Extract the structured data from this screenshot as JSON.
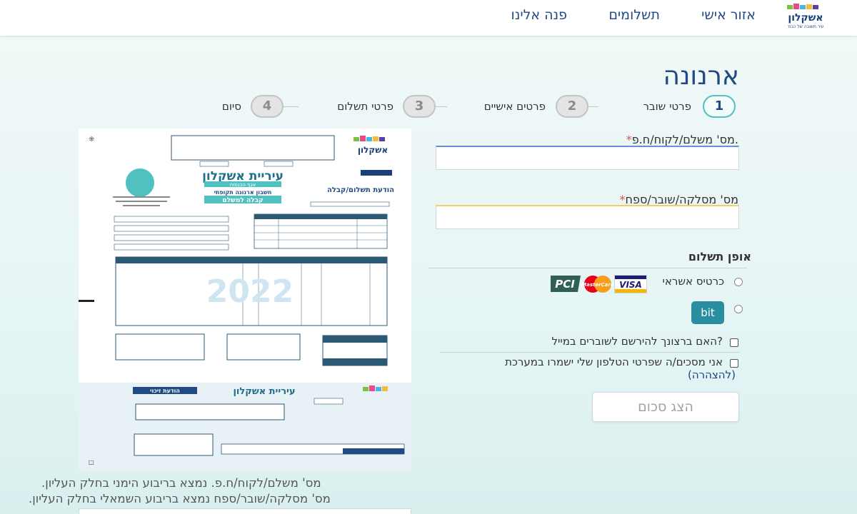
{
  "header": {
    "logo_text": "אשקלון",
    "logo_sub": "עיר תשובה של כבוד",
    "nav": [
      "אזור אישי",
      "תשלומים",
      "פנה אלינו"
    ]
  },
  "page": {
    "title": "ארנונה"
  },
  "stepper": [
    {
      "number": "1",
      "label": "פרטי שובר"
    },
    {
      "number": "2",
      "label": "פרטים אישיים"
    },
    {
      "number": "3",
      "label": "פרטי תשלום"
    },
    {
      "number": "4",
      "label": "סיום"
    }
  ],
  "form": {
    "payer_label": "מס' משלם/לקוח/ח.פ.",
    "payer_value": "",
    "voucher_label": "מס' מסלקה/שובר/ספח",
    "voucher_value": "",
    "required_mark": "*",
    "payment_method_title": "אופן תשלום",
    "credit_label": "כרטיס אשראי",
    "bit_label": "bit",
    "card_logos": {
      "pci": "PCI",
      "mastercard": "MasterCard",
      "visa": "VISA"
    },
    "email_signup_label": "האם ברצונך להירשם לשוברים במייל?",
    "phone_consent_label": "אני מסכים/ה שפרטי הטלפון שלי ישמרו במערכת",
    "declaration_link": "(להצהרה)",
    "show_amount_button": "הצג סכום"
  },
  "bill": {
    "city": "עיריית אשקלון",
    "subtitle": "אגף הכנסות",
    "type": "חשבון ארנונה תקופתי",
    "receipt": "קבלה למשלם",
    "notice": "הודעת תשלום/קבלה",
    "year": "2022",
    "credit_notice": "הודעת זיכוי"
  },
  "hints": {
    "payer_hint": "מס' משלם/לקוח/ח.פ. נמצא בריבוע הימני בחלק העליון.",
    "voucher_hint": "מס' מסלקה/שובר/ספח נמצא בריבוע השמאלי בחלק העליון."
  },
  "colors": {
    "primary": "#1f4a82",
    "accent": "#4fc1c1",
    "required": "#d9534f"
  }
}
